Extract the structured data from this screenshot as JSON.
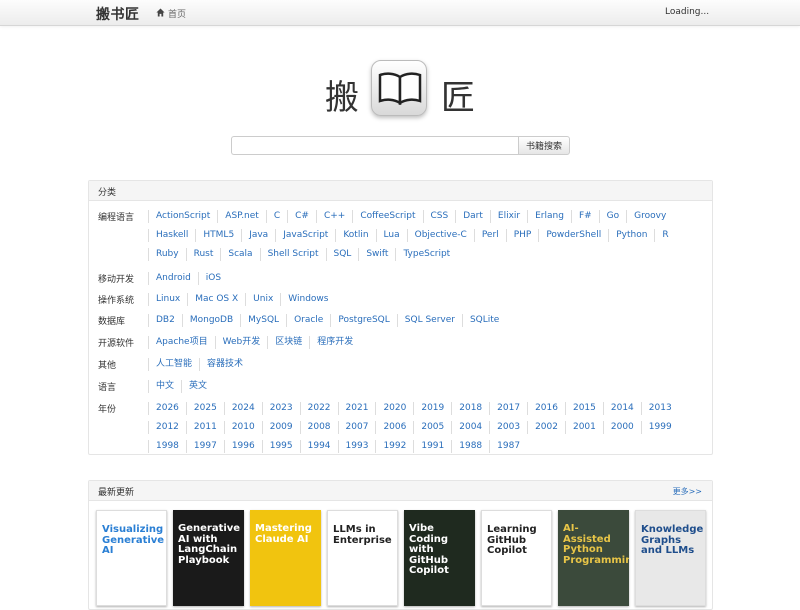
{
  "nav": {
    "brand": "搬书匠",
    "home": "首页",
    "status": "Loading..."
  },
  "logo": {
    "left_char": "搬",
    "right_char": "匠",
    "icon": "open-book-icon"
  },
  "search": {
    "placeholder": "",
    "button": "书籍搜索"
  },
  "categories": {
    "header": "分类",
    "rows": [
      {
        "label": "编程语言",
        "links": [
          "ActionScript",
          "ASP.net",
          "C",
          "C#",
          "C++",
          "CoffeeScript",
          "CSS",
          "Dart",
          "Elixir",
          "Erlang",
          "F#",
          "Go",
          "Groovy",
          "Haskell",
          "HTML5",
          "Java",
          "JavaScript",
          "Kotlin",
          "Lua",
          "Objective-C",
          "Perl",
          "PHP",
          "PowderShell",
          "Python",
          "R",
          "Ruby",
          "Rust",
          "Scala",
          "Shell Script",
          "SQL",
          "Swift",
          "TypeScript"
        ]
      },
      {
        "label": "移动开发",
        "links": [
          "Android",
          "iOS"
        ]
      },
      {
        "label": "操作系统",
        "links": [
          "Linux",
          "Mac OS X",
          "Unix",
          "Windows"
        ]
      },
      {
        "label": "数据库",
        "links": [
          "DB2",
          "MongoDB",
          "MySQL",
          "Oracle",
          "PostgreSQL",
          "SQL Server",
          "SQLite"
        ]
      },
      {
        "label": "开源软件",
        "links": [
          "Apache项目",
          "Web开发",
          "区块链",
          "程序开发"
        ]
      },
      {
        "label": "其他",
        "links": [
          "人工智能",
          "容器技术"
        ]
      },
      {
        "label": "语言",
        "links": [
          "中文",
          "英文"
        ]
      },
      {
        "label": "年份",
        "links": [
          "2026",
          "2025",
          "2024",
          "2023",
          "2022",
          "2021",
          "2020",
          "2019",
          "2018",
          "2017",
          "2016",
          "2015",
          "2014",
          "2013",
          "2012",
          "2011",
          "2010",
          "2009",
          "2008",
          "2007",
          "2006",
          "2005",
          "2004",
          "2003",
          "2002",
          "2001",
          "2000",
          "1999",
          "1998",
          "1997",
          "1996",
          "1995",
          "1994",
          "1993",
          "1992",
          "1991",
          "1988",
          "1987"
        ]
      }
    ]
  },
  "latest": {
    "header": "最新更新",
    "more": "更多>>",
    "books": [
      {
        "title": "Visualizing Generative AI",
        "bg": "#ffffff",
        "fg": "#2a7fd4"
      },
      {
        "title": "Generative AI with LangChain Playbook",
        "bg": "#1a1a1a",
        "fg": "#ffffff"
      },
      {
        "title": "Mastering Claude AI",
        "bg": "#f1c40f",
        "fg": "#ffffff"
      },
      {
        "title": "LLMs in Enterprise",
        "bg": "#ffffff",
        "fg": "#222222"
      },
      {
        "title": "Vibe Coding with GitHub Copilot",
        "bg": "#1f2a1f",
        "fg": "#ffffff"
      },
      {
        "title": "Learning GitHub Copilot",
        "bg": "#ffffff",
        "fg": "#222222"
      },
      {
        "title": "AI-Assisted Python Programming",
        "bg": "#3b4a3b",
        "fg": "#e8c547"
      },
      {
        "title": "Knowledge Graphs and LLMs",
        "bg": "#e8e8e8",
        "fg": "#1f4e8c"
      }
    ]
  }
}
